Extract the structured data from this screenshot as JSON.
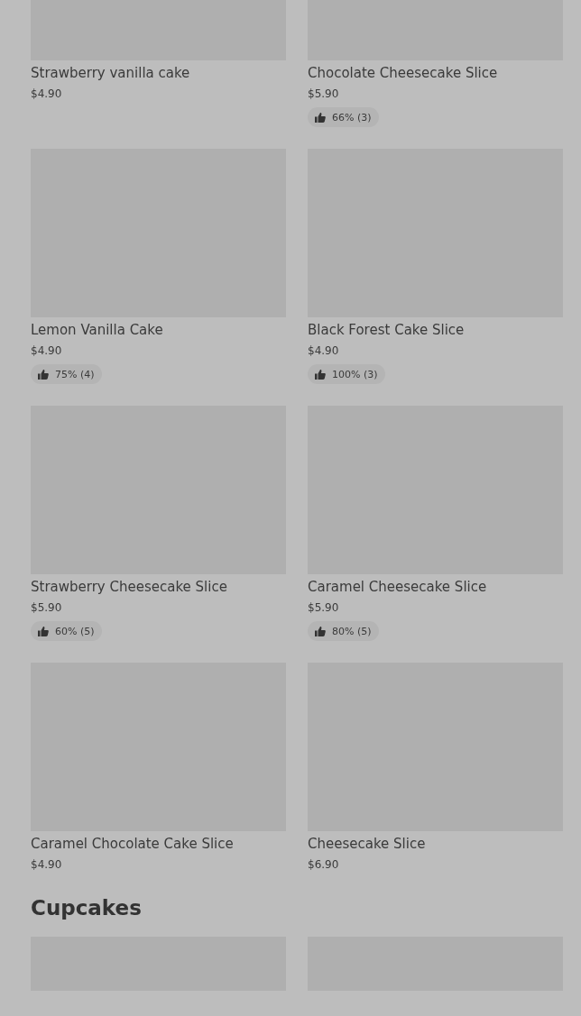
{
  "sections": [
    {
      "products": [
        {
          "name": "Strawberry vanilla cake",
          "price": "$4.90"
        },
        {
          "name": "Chocolate Cheesecake Slice",
          "price": "$5.90",
          "rating": "66% (3)"
        },
        {
          "name": "Lemon Vanilla Cake",
          "price": "$4.90",
          "rating": "75% (4)"
        },
        {
          "name": "Black Forest Cake Slice",
          "price": "$4.90",
          "rating": "100% (3)"
        },
        {
          "name": "Strawberry Cheesecake Slice",
          "price": "$5.90",
          "rating": "60% (5)"
        },
        {
          "name": "Caramel Cheesecake Slice",
          "price": "$5.90",
          "rating": "80% (5)"
        },
        {
          "name": "Caramel Chocolate Cake Slice",
          "price": "$4.90"
        },
        {
          "name": "Cheesecake Slice",
          "price": "$6.90"
        }
      ]
    },
    {
      "title": "Cupcakes"
    }
  ]
}
